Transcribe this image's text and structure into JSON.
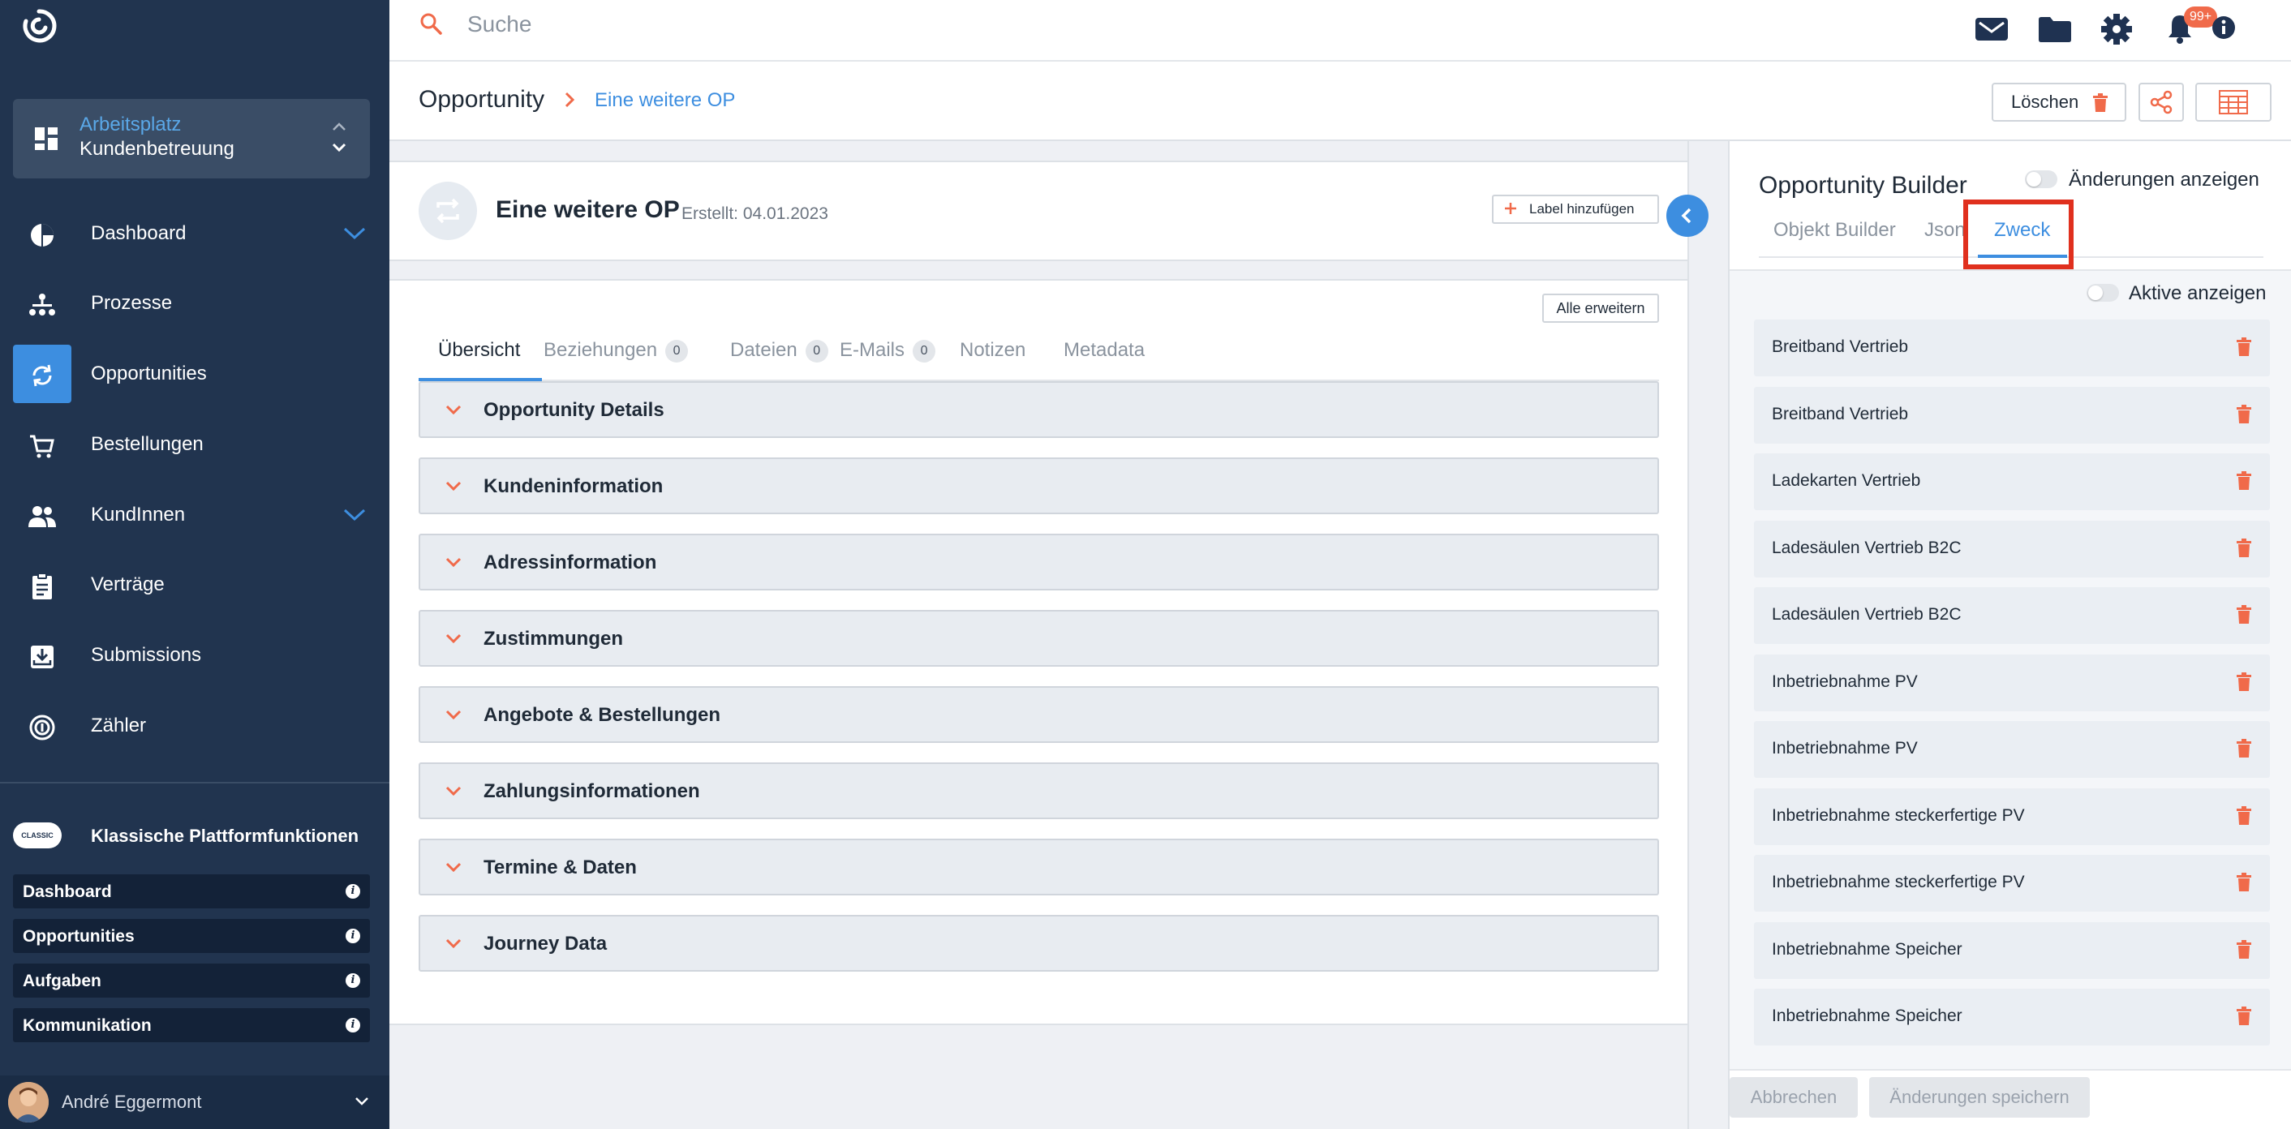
{
  "sidebar": {
    "workspace": {
      "label": "Arbeitsplatz",
      "value": "Kundenbetreuung"
    },
    "nav": [
      {
        "label": "Dashboard",
        "icon": "pie-chart-icon",
        "expandable": true,
        "active": false
      },
      {
        "label": "Prozesse",
        "icon": "org-chart-icon",
        "expandable": false,
        "active": false
      },
      {
        "label": "Opportunities",
        "icon": "refresh-icon",
        "expandable": false,
        "active": true
      },
      {
        "label": "Bestellungen",
        "icon": "cart-icon",
        "expandable": false,
        "active": false
      },
      {
        "label": "KundInnen",
        "icon": "users-icon",
        "expandable": true,
        "active": false
      },
      {
        "label": "Verträge",
        "icon": "clipboard-icon",
        "expandable": false,
        "active": false
      },
      {
        "label": "Submissions",
        "icon": "inbox-download-icon",
        "expandable": false,
        "active": false
      },
      {
        "label": "Zähler",
        "icon": "meter-icon",
        "expandable": false,
        "active": false
      }
    ],
    "classic": {
      "badge": "CLASSIC",
      "title": "Klassische Plattformfunktionen",
      "items": [
        {
          "label": "Dashboard"
        },
        {
          "label": "Opportunities"
        },
        {
          "label": "Aufgaben"
        },
        {
          "label": "Kommunikation"
        }
      ]
    },
    "user": {
      "name": "André Eggermont"
    }
  },
  "topbar": {
    "search_placeholder": "Suche",
    "notification_count": "99+",
    "icons": [
      "mail-icon",
      "folder-icon",
      "gear-icon",
      "bell-icon",
      "info-icon"
    ]
  },
  "breadcrumb": {
    "root": "Opportunity",
    "current": "Eine weitere OP",
    "delete_label": "Löschen"
  },
  "opportunity": {
    "title": "Eine weitere OP",
    "created": "Erstellt: 04.01.2023",
    "add_label": "Label hinzufügen",
    "expand_all": "Alle erweitern",
    "tabs": [
      {
        "label": "Übersicht",
        "count": null
      },
      {
        "label": "Beziehungen",
        "count": "0"
      },
      {
        "label": "Dateien",
        "count": "0"
      },
      {
        "label": "E-Mails",
        "count": "0"
      },
      {
        "label": "Notizen",
        "count": null
      },
      {
        "label": "Metadata",
        "count": null
      }
    ],
    "sections": [
      "Opportunity Details",
      "Kundeninformation",
      "Adressinformation",
      "Zustimmungen",
      "Angebote & Bestellungen",
      "Zahlungsinformationen",
      "Termine & Daten",
      "Journey Data"
    ]
  },
  "builder": {
    "title": "Opportunity Builder",
    "show_changes": "Änderungen anzeigen",
    "tabs": [
      "Objekt Builder",
      "Json",
      "Zweck"
    ],
    "active_tab": "Zweck",
    "show_active": "Aktive anzeigen",
    "items": [
      "Breitband Vertrieb",
      "Breitband Vertrieb",
      "Ladekarten Vertrieb",
      "Ladesäulen Vertrieb B2C",
      "Ladesäulen Vertrieb B2C",
      "Inbetriebnahme PV",
      "Inbetriebnahme PV",
      "Inbetriebnahme steckerfertige PV",
      "Inbetriebnahme steckerfertige PV",
      "Inbetriebnahme Speicher",
      "Inbetriebnahme Speicher"
    ],
    "cancel": "Abbrechen",
    "save": "Änderungen speichern"
  },
  "colors": {
    "sidebar": "#21344f",
    "accent_blue": "#3d8ee0",
    "accent_orange": "#f06a4a",
    "highlight_red": "#e0301e"
  }
}
